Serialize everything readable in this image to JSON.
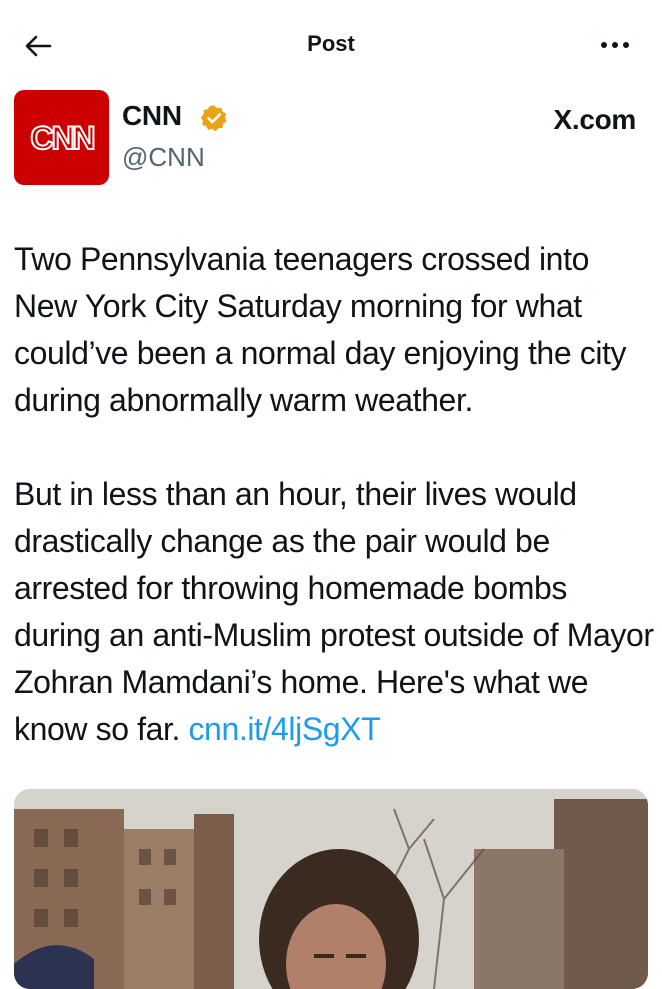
{
  "header": {
    "title": "Post",
    "back_icon": "arrow-left-icon",
    "more_icon": "more-horizontal-icon"
  },
  "author": {
    "avatar_label": "CNN",
    "avatar_color": "#cc0000",
    "name": "CNN",
    "handle": "@CNN",
    "verified_icon": "gold-verified-badge-icon",
    "verified_color": "#e8a317"
  },
  "watermark": "X.com",
  "tweet": {
    "paragraph1": "Two Pennsylvania teenagers crossed into New York City Saturday morning for what could’ve been a normal day enjoying the city during abnormally warm weather.",
    "paragraph2": "But in less than an hour, their lives would drastically change as the pair would be arrested for throwing homemade bombs during an anti-Muslim protest outside of Mayor Zohran Mamdani’s home. Here's what we know so far.",
    "link": "cnn.it/4ljSgXT",
    "link_color": "#1d9bf0"
  },
  "media": {
    "type": "photo"
  }
}
